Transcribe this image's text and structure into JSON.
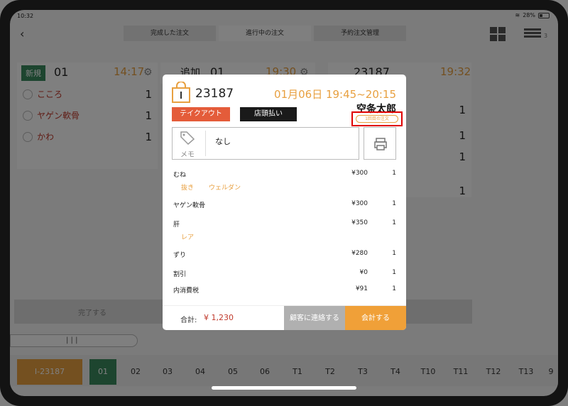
{
  "status": {
    "time": "10:32",
    "wifi": "wifi",
    "battery": "28%"
  },
  "nav": {
    "tabs": [
      "完成した注文",
      "進行中の注文",
      "予約注文管理"
    ],
    "badge": "3"
  },
  "columns": [
    {
      "tag": "新規",
      "num": "01",
      "time": "14:17",
      "items": [
        {
          "name": "こころ",
          "qty": "1"
        },
        {
          "name": "ヤゲン軟骨",
          "qty": "1"
        },
        {
          "name": "かわ",
          "qty": "1"
        }
      ]
    },
    {
      "tag": "追加",
      "num": "01",
      "time": "19:30"
    },
    {
      "num": "23187",
      "time": "19:32",
      "qtys": [
        "1",
        "1",
        "1",
        "1"
      ]
    }
  ],
  "bottom": {
    "label": "完了する",
    "scroll": "| | |"
  },
  "tables": [
    "I-23187",
    "01",
    "02",
    "03",
    "04",
    "05",
    "06",
    "T1",
    "T2",
    "T3",
    "T4",
    "T10",
    "T11",
    "T12",
    "T13",
    "9"
  ],
  "modal": {
    "order_no": "23187",
    "slot": "01月06日 19:45~20:15",
    "customer": "空条太郎",
    "type_label": "テイクアウト",
    "pay_label": "店頭払い",
    "first_order": "1回目の注文",
    "memo_label": "メモ",
    "memo_text": "なし",
    "lines": [
      {
        "name": "むね",
        "price": "¥300",
        "qty": "1",
        "mods": [
          "抜き",
          "ウェルダン"
        ]
      },
      {
        "name": "ヤゲン軟骨",
        "price": "¥300",
        "qty": "1"
      },
      {
        "name": "肝",
        "price": "¥350",
        "qty": "1",
        "mods": [
          "レア"
        ]
      },
      {
        "name": "ずり",
        "price": "¥280",
        "qty": "1"
      },
      {
        "name": "割引",
        "price": "¥0",
        "qty": "1"
      },
      {
        "name": "内消費税",
        "price": "¥91",
        "qty": "1"
      }
    ],
    "total_label": "合計:",
    "total_value": "¥ 1,230",
    "contact_label": "顧客に連絡する",
    "checkout_label": "会計する"
  },
  "colors": {
    "accent": "#e8a040",
    "takeout": "#e45c3a",
    "highlight": "#e00000"
  }
}
